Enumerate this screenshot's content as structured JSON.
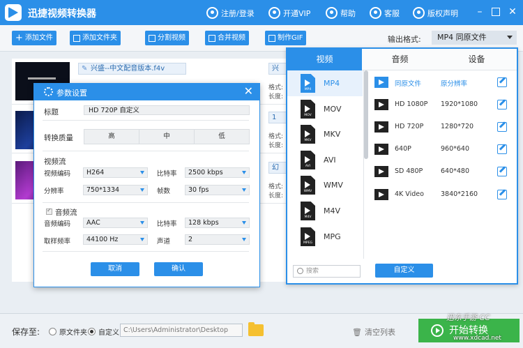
{
  "app": {
    "title": "迅捷视频转换器",
    "top_links": [
      "注册/登录",
      "开通VIP",
      "帮助",
      "客服",
      "版权声明"
    ]
  },
  "toolbar": {
    "add_file": "添加文件",
    "add_folder": "添加文件夹",
    "split_video": "分割视频",
    "merge_video": "合并视频",
    "make_gif": "制作GIF",
    "output_format_label": "输出格式:",
    "output_format_value": "MP4  同原文件"
  },
  "file_list": {
    "items": [
      {
        "name": "兴盛--中文配音版本.f4v",
        "name2": "兴",
        "meta_a": "格式:",
        "meta_b": "长度:"
      },
      {
        "name": "",
        "name2": "1",
        "meta_a": "格式:",
        "meta_b": "长度:"
      },
      {
        "name": "",
        "name2": "幻",
        "meta_a": "格式:",
        "meta_b": "长度:"
      }
    ]
  },
  "format_panel": {
    "tabs": [
      "视频",
      "音频",
      "设备"
    ],
    "formats": [
      "MP4",
      "MOV",
      "MKV",
      "AVI",
      "WMV",
      "M4V",
      "MPG"
    ],
    "qualities": [
      {
        "name": "同原文件",
        "res": "原分辨率"
      },
      {
        "name": "HD 1080P",
        "res": "1920*1080"
      },
      {
        "name": "HD 720P",
        "res": "1280*720"
      },
      {
        "name": "640P",
        "res": "960*640"
      },
      {
        "name": "SD 480P",
        "res": "640*480"
      },
      {
        "name": "4K Video",
        "res": "3840*2160"
      }
    ],
    "search_placeholder": "搜索",
    "custom_button": "自定义"
  },
  "dialog": {
    "title": "参数设置",
    "title_label": "标题",
    "title_value": "HD 720P 自定义",
    "quality_label": "转换质量",
    "quality_options": [
      "高",
      "中",
      "低"
    ],
    "video_section": "视频流",
    "video_codec_label": "视频编码",
    "video_codec": "H264",
    "video_bitrate_label": "比特率",
    "video_bitrate": "2500 kbps",
    "resolution_label": "分辨率",
    "resolution": "750*1334",
    "fps_label": "帧数",
    "fps": "30 fps",
    "audio_section": "音频流",
    "audio_codec_label": "音频编码",
    "audio_codec": "AAC",
    "audio_bitrate_label": "比特率",
    "audio_bitrate": "128 kbps",
    "sample_rate_label": "取样频率",
    "sample_rate": "44100 Hz",
    "channel_label": "声道",
    "channel": "2",
    "cancel": "取消",
    "confirm": "确认"
  },
  "bottom": {
    "save_to_label": "保存至:",
    "option_original": "原文件夹",
    "option_custom": "自定义",
    "path": "C:\\Users\\Administrator\\Desktop",
    "clear_list": "清空列表",
    "start": "开始转换"
  },
  "watermark": {
    "line1": "迅东手游 CC",
    "line2": "www.xdcad.net"
  }
}
